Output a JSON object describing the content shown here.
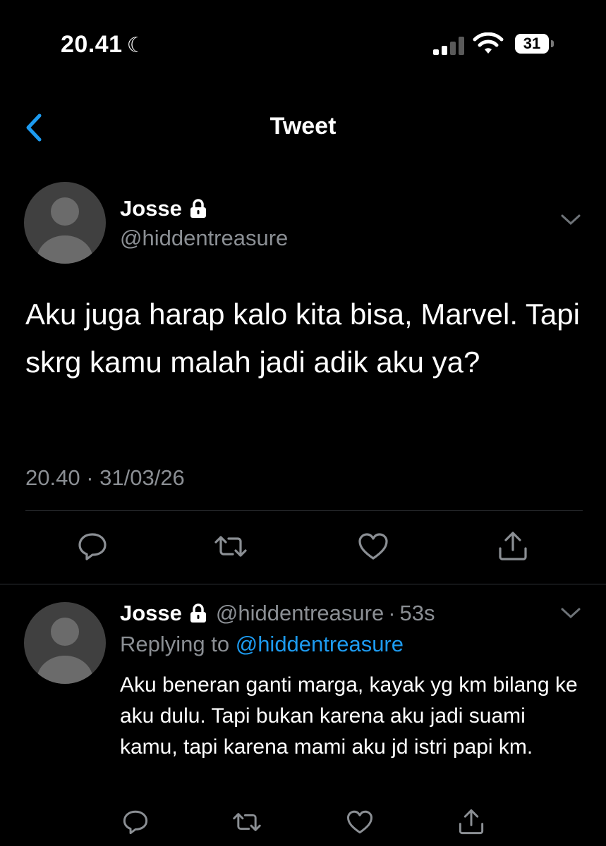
{
  "status_bar": {
    "time": "20.41",
    "moon": "☾",
    "battery": "31"
  },
  "nav": {
    "title": "Tweet"
  },
  "tweet": {
    "name": "Josse",
    "handle": "@hiddentreasure",
    "text": "Aku juga harap kalo kita bisa, Marvel. Tapi skrg kamu malah jadi adik aku ya?",
    "timestamp": "20.40 · 31/03/26"
  },
  "reply": {
    "name": "Josse",
    "handle": "@hiddentreasure",
    "separator": "·",
    "time": "53s",
    "replying_prefix": "Replying to",
    "replying_to": "@hiddentreasure",
    "text": "Aku beneran ganti marga, kayak yg km bilang ke aku dulu. Tapi bukan karena aku jadi suami kamu, tapi karena mami aku jd istri papi km."
  },
  "colors": {
    "background": "#000000",
    "secondary_text": "#8b8f94",
    "link": "#1d9bf0",
    "divider": "#2f3336"
  },
  "icons": {
    "back": "chevron-left-icon",
    "lock": "lock-icon",
    "more": "chevron-down-icon",
    "reply": "comment-icon",
    "retweet": "retweet-icon",
    "like": "heart-icon",
    "share": "share-icon"
  }
}
